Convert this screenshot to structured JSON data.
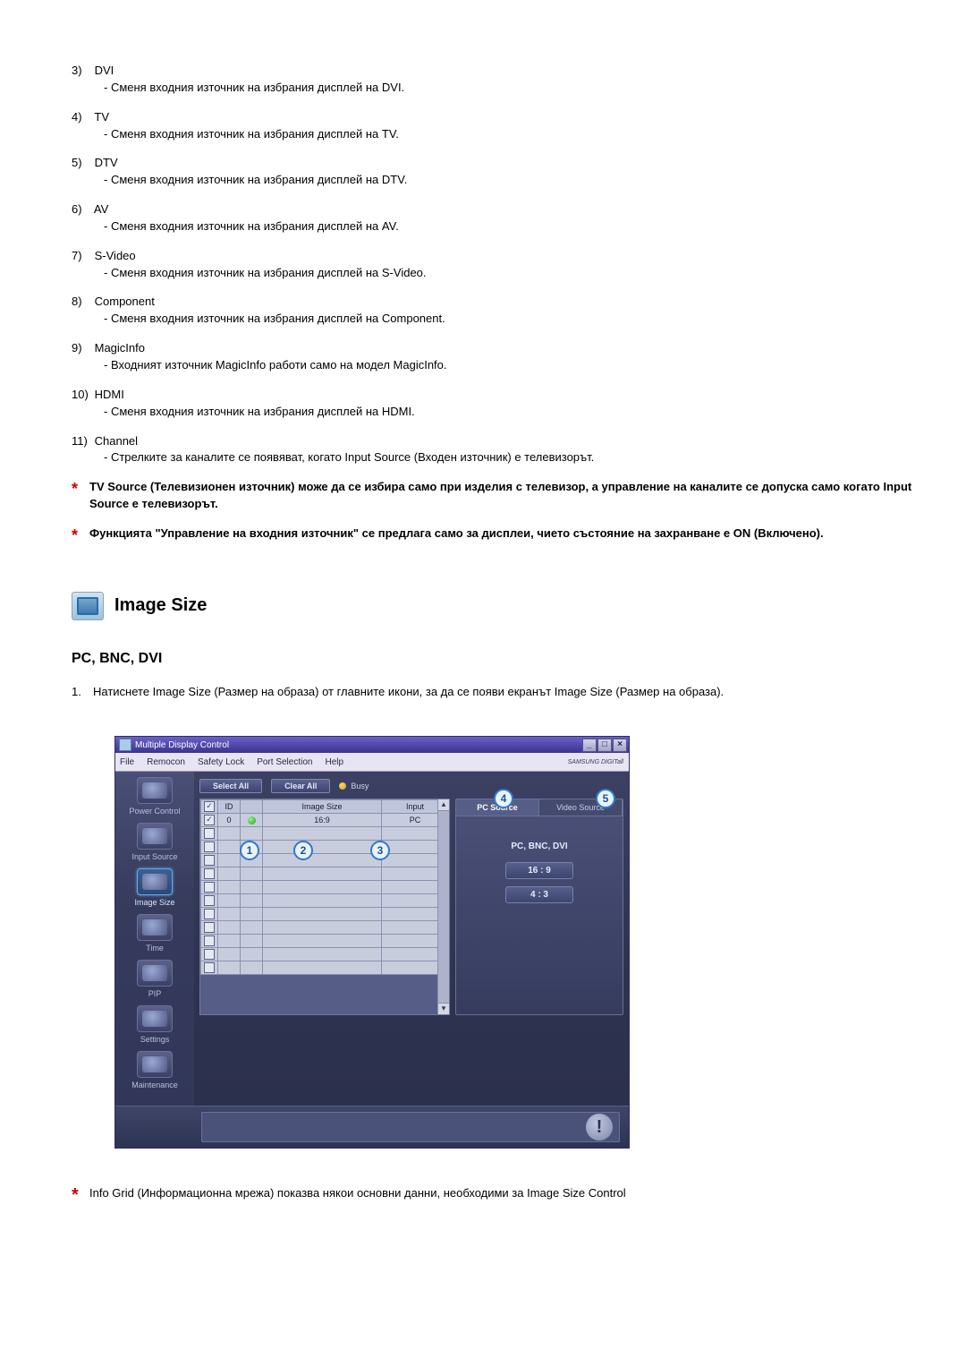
{
  "numbered_list": [
    {
      "num": "3)",
      "title": "DVI",
      "desc": "- Сменя входния източник на избрания дисплей на DVI."
    },
    {
      "num": "4)",
      "title": "TV",
      "desc": "- Сменя входния източник на избрания дисплей на TV."
    },
    {
      "num": "5)",
      "title": "DTV",
      "desc": "- Сменя входния източник на избрания дисплей на DTV."
    },
    {
      "num": "6)",
      "title": "AV",
      "desc": "- Сменя входния източник на избрания дисплей на AV."
    },
    {
      "num": "7)",
      "title": "S-Video",
      "desc": "- Сменя входния източник на избрания дисплей на S-Video."
    },
    {
      "num": "8)",
      "title": "Component",
      "desc": "- Сменя входния източник на избрания дисплей на Component."
    },
    {
      "num": "9)",
      "title": "MagicInfo",
      "desc": "- Входният източник MagicInfo работи само на модел MagicInfo."
    },
    {
      "num": "10)",
      "title": "HDMI",
      "desc": "- Сменя входния източник на избрания дисплей на HDMI."
    },
    {
      "num": "11)",
      "title": "Channel",
      "desc": "- Стрелките за каналите се появяват, когато Input Source (Входен източник) е телевизорът."
    }
  ],
  "star_notes": [
    "TV Source (Телевизионен източник) може да се избира само при изделия с телевизор, а управление на каналите се допуска само когато Input Source е телевизорът.",
    "Функцията \"Управление на входния източник\" се предлага само за дисплеи, чието състояние на захранване е ON (Включено)."
  ],
  "section_title": "Image Size",
  "sub_header": "PC, BNC, DVI",
  "step1_num": "1.",
  "step1_text": "Натиснете Image Size (Размер на образа) от главните икони, за да се появи екранът Image Size (Размер на образа).",
  "app": {
    "title": "Multiple Display Control",
    "window_controls": {
      "min": "_",
      "max": "□",
      "close": "×"
    },
    "menu": [
      "File",
      "Remocon",
      "Safety Lock",
      "Port Selection",
      "Help"
    ],
    "brand": "SAMSUNG DIGITall",
    "sidebar": [
      {
        "label": "Power Control",
        "active": false
      },
      {
        "label": "Input Source",
        "active": false
      },
      {
        "label": "Image Size",
        "active": true
      },
      {
        "label": "Time",
        "active": false
      },
      {
        "label": "PIP",
        "active": false
      },
      {
        "label": "Settings",
        "active": false
      },
      {
        "label": "Maintenance",
        "active": false
      }
    ],
    "toolbar": {
      "select_all": "Select All",
      "clear_all": "Clear All",
      "busy": "Busy"
    },
    "grid": {
      "headers": {
        "chk": "",
        "id": "ID",
        "status": "",
        "image_size": "Image Size",
        "input": "Input"
      },
      "row": {
        "id": "0",
        "image_size": "16:9",
        "input": "PC"
      },
      "empty_rows": 11
    },
    "callouts": {
      "c1": "1",
      "c2": "2",
      "c3": "3",
      "c4": "4",
      "c5": "5"
    },
    "right_panel": {
      "tab_pc": "PC Source",
      "tab_video": "Video Source",
      "title": "PC, BNC, DVI",
      "opt1": "16 : 9",
      "opt2": "4 : 3"
    },
    "alert_glyph": "!"
  },
  "footer_note": "Info Grid (Информационна мрежа) показва някои основни данни, необходими за Image Size Control"
}
